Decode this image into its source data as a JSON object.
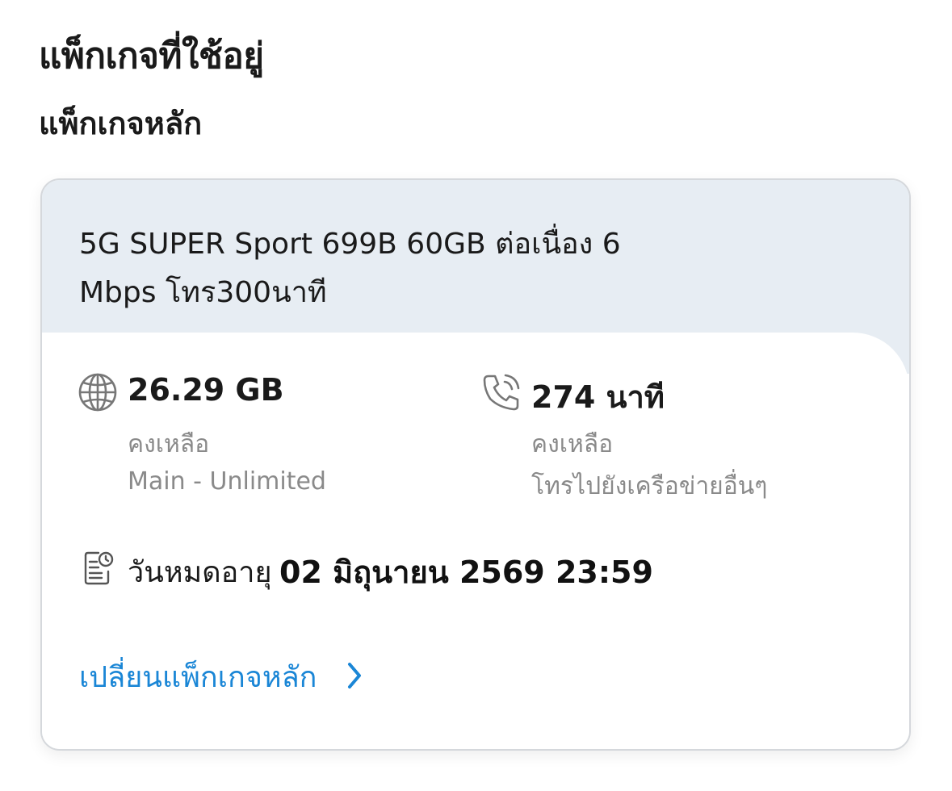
{
  "page": {
    "title": "แพ็กเกจที่ใช้อยู่",
    "section_title": "แพ็กเกจหลัก"
  },
  "package": {
    "name": "5G SUPER Sport 699B 60GB ต่อเนื่อง 6 Mbps โทร300นาที"
  },
  "data_balance": {
    "icon": "globe-icon",
    "value": "26.29 GB",
    "label": "คงเหลือ",
    "sub": "Main - Unlimited"
  },
  "voice_balance": {
    "icon": "phone-icon",
    "value": "274 นาที",
    "label": "คงเหลือ",
    "sub": "โทรไปยังเครือข่ายอื่นๆ"
  },
  "expiry": {
    "icon": "expiry-document-icon",
    "label": "วันหมดอายุ",
    "date": "02 มิถุนายน 2569 23:59"
  },
  "actions": {
    "change_package_label": "เปลี่ยนแพ็กเกจหลัก",
    "change_package_icon": "chevron-right-icon"
  },
  "colors": {
    "header_bg": "#e7edf3",
    "link": "#1a86d6",
    "muted_text": "#8a8a8a",
    "text": "#1a1a1a"
  }
}
